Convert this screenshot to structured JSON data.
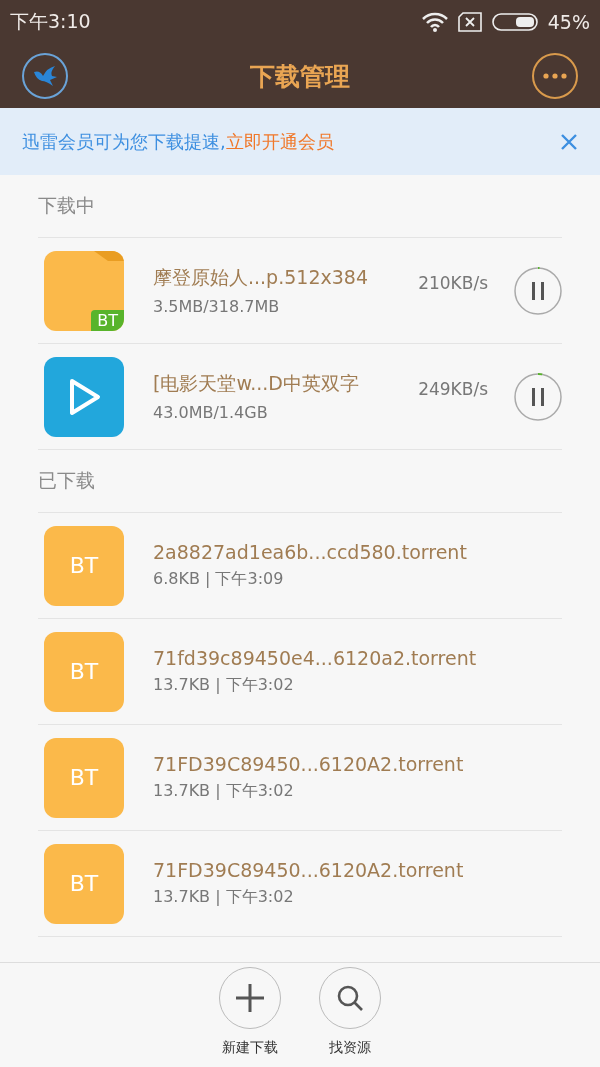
{
  "status_bar": {
    "time": "下午3:10",
    "battery": "45%"
  },
  "header": {
    "title": "下载管理"
  },
  "banner": {
    "text": "迅雷会员可为您下载提速,",
    "link": "立即开通会员"
  },
  "sections": [
    {
      "title": "下载中",
      "items": [
        {
          "kind": "folder",
          "badge": "BT",
          "name": "摩登原始人...p.512x384",
          "size": "3.5MB/318.7MB",
          "speed": "210KB/s",
          "level": 0.011
        },
        {
          "kind": "video",
          "name": "[电影天堂w...D中英双字",
          "size": "43.0MB/1.4GB",
          "speed": "249KB/s",
          "level": 0.03
        }
      ]
    },
    {
      "title": "已下载",
      "items": [
        {
          "kind": "bt",
          "badge": "BT",
          "name": "2a8827ad1ea6b...ccd580.torrent",
          "size": "6.8KB | 下午3:09"
        },
        {
          "kind": "bt",
          "badge": "BT",
          "name": "71fd39c89450e4...6120a2.torrent",
          "size": "13.7KB | 下午3:02"
        },
        {
          "kind": "bt",
          "badge": "BT",
          "name": "71FD39C89450...6120A2.torrent",
          "size": "13.7KB | 下午3:02"
        },
        {
          "kind": "bt",
          "badge": "BT",
          "name": "71FD39C89450...6120A2.torrent",
          "size": "13.7KB | 下午3:02"
        }
      ]
    }
  ],
  "bottom_bar": [
    {
      "kind": "add",
      "label": "新建下载"
    },
    {
      "kind": "search",
      "label": "找资源"
    }
  ]
}
